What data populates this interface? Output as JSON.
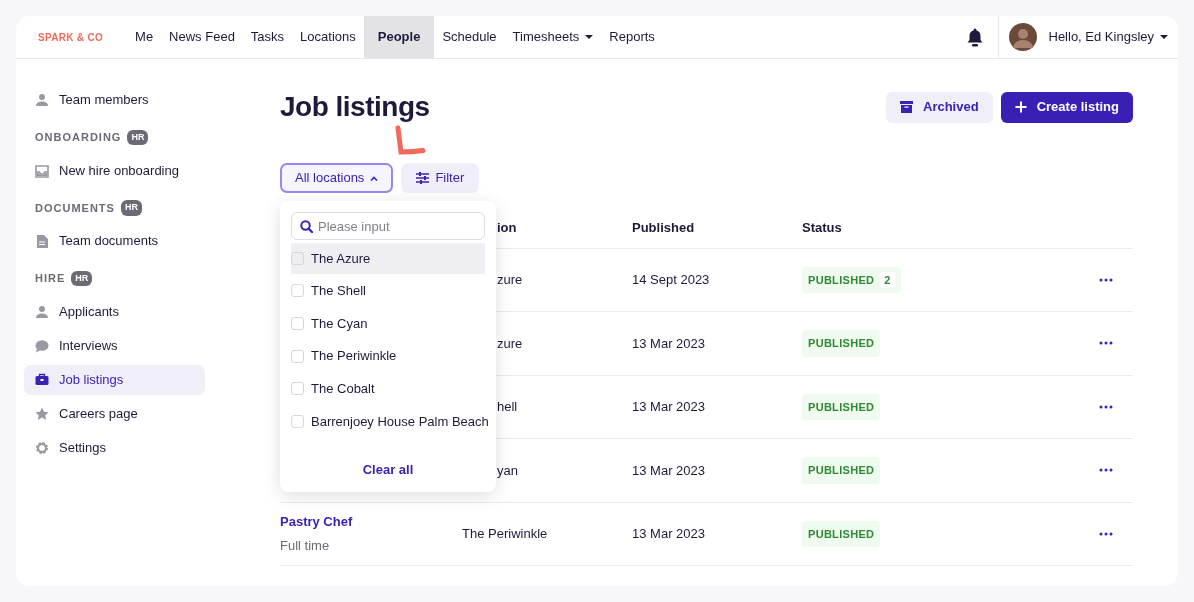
{
  "brand": "SPARK & CO",
  "nav": [
    {
      "label": "Me",
      "selected": false,
      "caret": false
    },
    {
      "label": "News Feed",
      "selected": false,
      "caret": false
    },
    {
      "label": "Tasks",
      "selected": false,
      "caret": false
    },
    {
      "label": "Locations",
      "selected": false,
      "caret": false
    },
    {
      "label": "People",
      "selected": true,
      "caret": false
    },
    {
      "label": "Schedule",
      "selected": false,
      "caret": false
    },
    {
      "label": "Timesheets",
      "selected": false,
      "caret": true
    },
    {
      "label": "Reports",
      "selected": false,
      "caret": false
    }
  ],
  "user": {
    "greeting": "Hello, Ed Kingsley"
  },
  "sidebar": {
    "groups": [
      {
        "items": [
          {
            "label": "Team members",
            "selected": false
          }
        ]
      },
      {
        "heading": "ONBOARDING",
        "badge": "HR",
        "items": [
          {
            "label": "New hire onboarding",
            "selected": false
          }
        ]
      },
      {
        "heading": "DOCUMENTS",
        "badge": "HR",
        "items": [
          {
            "label": "Team documents",
            "selected": false
          }
        ]
      },
      {
        "heading": "HIRE",
        "badge": "HR",
        "items": [
          {
            "label": "Applicants",
            "selected": false
          },
          {
            "label": "Interviews",
            "selected": false
          },
          {
            "label": "Job listings",
            "selected": true
          },
          {
            "label": "Careers page",
            "selected": false
          },
          {
            "label": "Settings",
            "selected": false
          }
        ]
      }
    ]
  },
  "page": {
    "title": "Job listings",
    "buttons": [
      {
        "label": "Archived",
        "kind": "secondary"
      },
      {
        "label": "Create listing",
        "kind": "primary"
      }
    ]
  },
  "filters": {
    "location_button": {
      "label": "All locations",
      "expanded": true
    },
    "filter_button": {
      "label": "Filter"
    }
  },
  "location_menu": {
    "search": {
      "placeholder": "Please input"
    },
    "options": [
      {
        "label": "The Azure",
        "checked": false,
        "hovered": true
      },
      {
        "label": "The Shell",
        "checked": false,
        "hovered": false
      },
      {
        "label": "The Cyan",
        "checked": false,
        "hovered": false
      },
      {
        "label": "The Periwinkle",
        "checked": false,
        "hovered": false
      },
      {
        "label": "The Cobalt",
        "checked": false,
        "hovered": false
      },
      {
        "label": "Barrenjoey House Palm Beach",
        "checked": false,
        "hovered": false
      }
    ],
    "clear_label": "Clear all"
  },
  "table": {
    "columns": [
      "ion",
      "Published",
      "Status"
    ],
    "rows": [
      {
        "location": "zure",
        "published": "14 Sept 2023",
        "status": "PUBLISHED",
        "count": "2"
      },
      {
        "location": "zure",
        "published": "13 Mar 2023",
        "status": "PUBLISHED"
      },
      {
        "location": "hell",
        "published": "13 Mar 2023",
        "status": "PUBLISHED"
      },
      {
        "location": "yan",
        "published": "13 Mar 2023",
        "status": "PUBLISHED"
      },
      {
        "title": "Pastry Chef",
        "type": "Full time",
        "location": "The Periwinkle",
        "published": "13 Mar 2023",
        "status": "PUBLISHED"
      }
    ]
  }
}
